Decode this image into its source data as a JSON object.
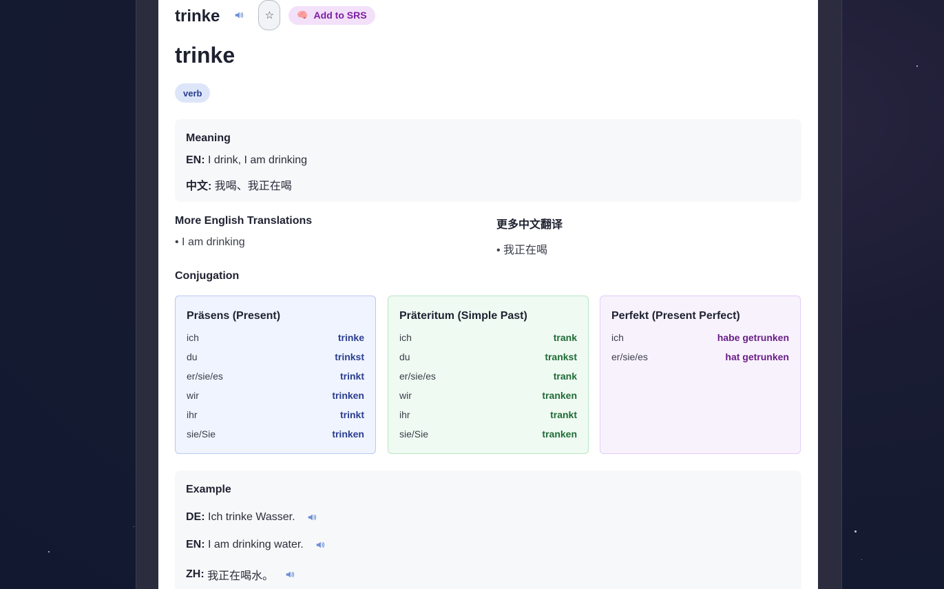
{
  "header": {
    "word": "trinke",
    "star_symbol": "☆",
    "srs_label": "Add to SRS",
    "srs_icon": "🧠"
  },
  "entry": {
    "title": "trinke",
    "part_of_speech": "verb"
  },
  "meaning": {
    "title": "Meaning",
    "en_label": "EN:",
    "en_value": "I drink, I am drinking",
    "zh_label": "中文:",
    "zh_value": "我喝、我正在喝"
  },
  "more_translations": {
    "english": {
      "title": "More English Translations",
      "items": [
        "• I am drinking"
      ]
    },
    "chinese": {
      "title": "更多中文翻译",
      "items": [
        "• 我正在喝"
      ]
    }
  },
  "conjugation": {
    "title": "Conjugation",
    "tenses": [
      {
        "title": "Präsens (Present)",
        "accent": "#2a3d8f",
        "rows": [
          {
            "pronoun": "ich",
            "form": "trinke"
          },
          {
            "pronoun": "du",
            "form": "trinkst"
          },
          {
            "pronoun": "er/sie/es",
            "form": "trinkt"
          },
          {
            "pronoun": "wir",
            "form": "trinken"
          },
          {
            "pronoun": "ihr",
            "form": "trinkt"
          },
          {
            "pronoun": "sie/Sie",
            "form": "trinken"
          }
        ]
      },
      {
        "title": "Präteritum (Simple Past)",
        "accent": "#1f6b35",
        "rows": [
          {
            "pronoun": "ich",
            "form": "trank"
          },
          {
            "pronoun": "du",
            "form": "trankst"
          },
          {
            "pronoun": "er/sie/es",
            "form": "trank"
          },
          {
            "pronoun": "wir",
            "form": "tranken"
          },
          {
            "pronoun": "ihr",
            "form": "trankt"
          },
          {
            "pronoun": "sie/Sie",
            "form": "tranken"
          }
        ]
      },
      {
        "title": "Perfekt (Present Perfect)",
        "accent": "#6a1d86",
        "rows": [
          {
            "pronoun": "ich",
            "form": "habe getrunken"
          },
          {
            "pronoun": "er/sie/es",
            "form": "hat getrunken"
          }
        ]
      }
    ]
  },
  "example": {
    "title": "Example",
    "lines": [
      {
        "label": "DE:",
        "text": "Ich trinke Wasser."
      },
      {
        "label": "EN:",
        "text": "I am drinking water."
      },
      {
        "label": "ZH:",
        "text": "我正在喝水。"
      }
    ]
  }
}
